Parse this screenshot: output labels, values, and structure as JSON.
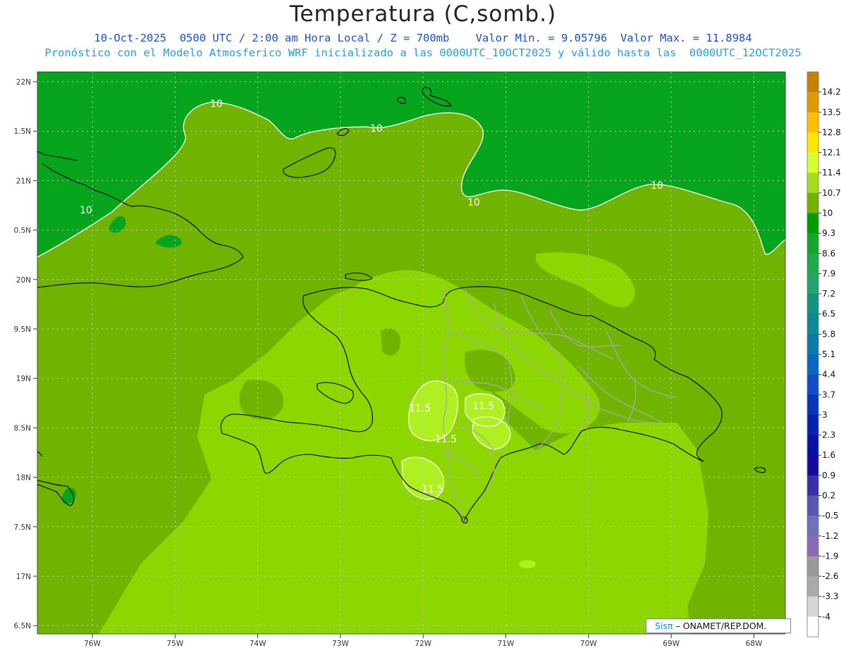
{
  "title": "Temperatura (C,somb.)",
  "subtitle_line1": "10-Oct-2025  0500 UTC / 2:00 am Hora Local / Z = 700mb    Valor Min. = 9.05796  Valor Max. = 11.8984",
  "subtitle_line2": "Pronóstico con el Modelo Atmosferico WRF inicializado a las 0000UTC_10OCT2025 y válido hasta las  0000UTC_12OCT2025",
  "lat_labels": [
    "22N",
    "1.5N",
    "21N",
    "0.5N",
    "20N",
    "9.5N",
    "19N",
    "8.5N",
    "18N",
    "7.5N",
    "17N",
    "6.5N"
  ],
  "lon_labels": [
    "76W",
    "75W",
    "74W",
    "73W",
    "72W",
    "71W",
    "70W",
    "69W",
    "68W"
  ],
  "contour_labels": [
    "10",
    "10",
    "10",
    "10",
    "10",
    "11.5",
    "11.5",
    "11.5",
    "11.5"
  ],
  "colorbar": {
    "labels": [
      "14.2",
      "13.5",
      "12.8",
      "12.1",
      "11.4",
      "10.7",
      "10",
      "9.3",
      "8.6",
      "7.9",
      "7.2",
      "6.5",
      "5.8",
      "5.1",
      "4.4",
      "3.7",
      "3",
      "2.3",
      "1.6",
      "0.9",
      "0.2",
      "-0.5",
      "-1.2",
      "-1.9",
      "-2.6",
      "-3.3",
      "-4"
    ],
    "colors": [
      "#c88000",
      "#e39a00",
      "#ffbf00",
      "#ffe600",
      "#d8ff30",
      "#a6dc1c",
      "#74b000",
      "#009d00",
      "#14a62e",
      "#20a84c",
      "#22a46a",
      "#14927e",
      "#0e8896",
      "#0a79ac",
      "#0c66be",
      "#0d4ec6",
      "#0834b8",
      "#0622b0",
      "#0613a0",
      "#120a9c",
      "#3a2ea8",
      "#5858b0",
      "#7070b8",
      "#8a6ab6",
      "#9a9a9a",
      "#aaaaaa",
      "#d6d6d6",
      "#ffffff"
    ]
  },
  "map_colors": {
    "band_9_3": "#07a51e",
    "band_10": "#70b400",
    "band_10_7": "#8ed600",
    "band_11_4": "#aef020",
    "contour": "#ffffff",
    "coast": "#000000",
    "provinces": "#a8a8a8",
    "grid": "#c8c8c8"
  },
  "credit": {
    "brand": "Sisπ",
    "text": " –  ONAMET/REP.DOM."
  }
}
